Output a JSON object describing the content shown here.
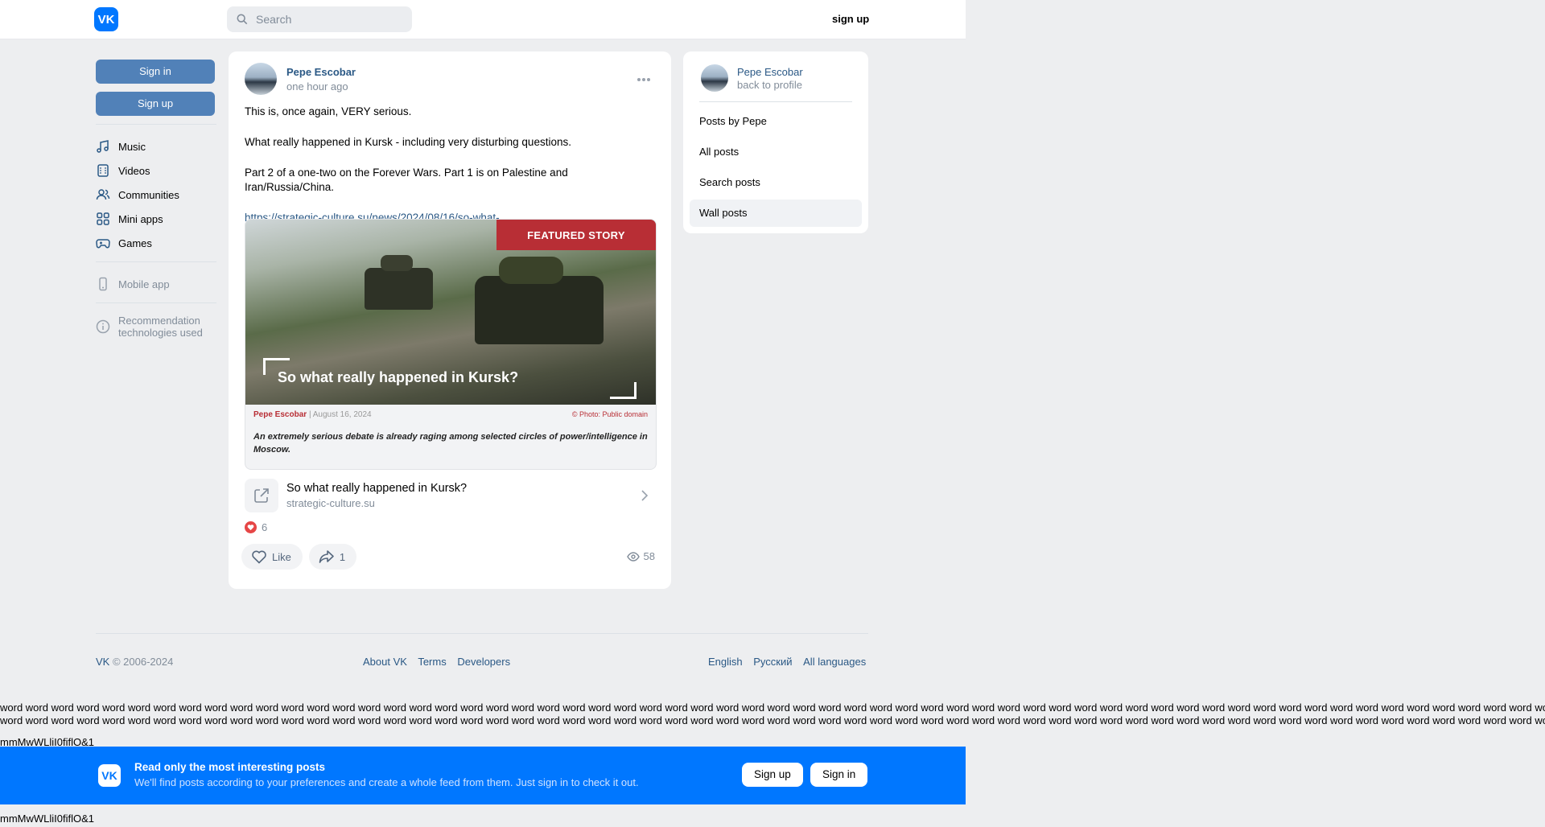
{
  "header": {
    "logo": "VK",
    "search_placeholder": "Search",
    "signup": "sign up"
  },
  "left": {
    "sign_in": "Sign in",
    "sign_up": "Sign up",
    "nav": [
      {
        "label": "Music",
        "icon": "music-icon"
      },
      {
        "label": "Videos",
        "icon": "video-icon"
      },
      {
        "label": "Communities",
        "icon": "users-icon"
      },
      {
        "label": "Mini apps",
        "icon": "apps-icon"
      },
      {
        "label": "Games",
        "icon": "gamepad-icon"
      }
    ],
    "mobile_app": "Mobile app",
    "recommendation": "Recommendation technologies used"
  },
  "post": {
    "author": "Pepe Escobar",
    "time": "one hour ago",
    "paragraphs": [
      "This is, once again, VERY serious.",
      "What really happened in Kursk - including very disturbing questions.",
      "Part 2 of a one-two on the Forever Wars. Part 1 is on Palestine and Iran/Russia/China."
    ],
    "link": "https://strategic-culture.su/news/2024/08/16/so-what-..",
    "image": {
      "badge": "FEATURED STORY",
      "headline": "So what really happened in Kursk?",
      "byline": "Pepe Escobar",
      "date": "August 16, 2024",
      "photo_credit": "© Photo: Public domain",
      "lead": "An extremely serious debate is already raging among selected circles of power/intelligence in Moscow."
    },
    "card": {
      "title": "So what really happened in Kursk?",
      "domain": "strategic-culture.su"
    },
    "reactions": "6",
    "like": "Like",
    "shares": "1",
    "views": "58"
  },
  "right": {
    "name": "Pepe Escobar",
    "back": "back to profile",
    "items": [
      "Posts by Pepe",
      "All posts",
      "Search posts",
      "Wall posts"
    ]
  },
  "footer": {
    "copyright": "VK © 2006-2024",
    "links": [
      "About VK",
      "Terms",
      "Developers"
    ],
    "langs": [
      "English",
      "Русский",
      "All languages"
    ]
  },
  "debug": {
    "words_line": "word word word word word word word word word word word word word word word word word word word word word word word word word word word word word word word word word word word word word word word word word word word word word word word word word word word word word word word word word word word word word word word word word word word word word word word word word word word",
    "measure": "mmMwWLliI0fiflO&1"
  },
  "banner": {
    "title": "Read only the most interesting posts",
    "subtitle": "We'll find posts according to your preferences and create a whole feed from them. Just sign in to check it out.",
    "signup": "Sign up",
    "signin": "Sign in"
  },
  "colors": {
    "accent": "#0077ff",
    "link": "#2a5885",
    "button": "#5181b8",
    "badge": "#b82e35"
  }
}
